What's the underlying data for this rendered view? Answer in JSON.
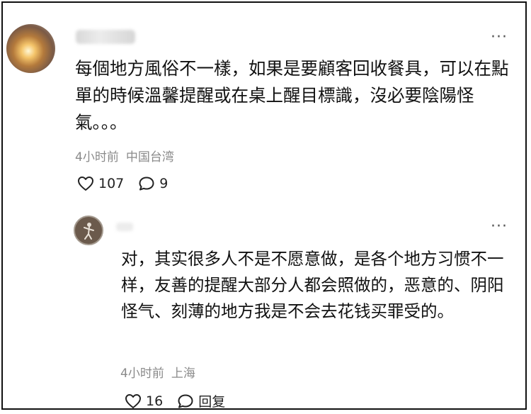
{
  "comment": {
    "menu_glyph": "···",
    "text": "每個地方風俗不一樣，如果是要顧客回收餐具，可以在點單的時候溫馨提醒或在桌上醒目標識，沒必要陰陽怪氣。。。",
    "time": "4小时前",
    "location": "中国台湾",
    "like_count": "107",
    "reply_count": "9"
  },
  "reply": {
    "menu_glyph": "···",
    "text": "对，其实很多人不是不愿意做，是各个地方习惯不一样，友善的提醒大部分人都会照做的，恶意的、阴阳怪气、刻薄的地方我是不会去花钱买罪受的。",
    "time": "4小时前",
    "location": "上海",
    "like_count": "16",
    "reply_label": "回复"
  },
  "icons": {
    "like": "heart-outline-icon",
    "comment": "speech-bubble-icon",
    "more": "more-dots-icon"
  },
  "colors": {
    "text": "#111111",
    "meta": "#8a8a8a",
    "border": "#111111"
  }
}
